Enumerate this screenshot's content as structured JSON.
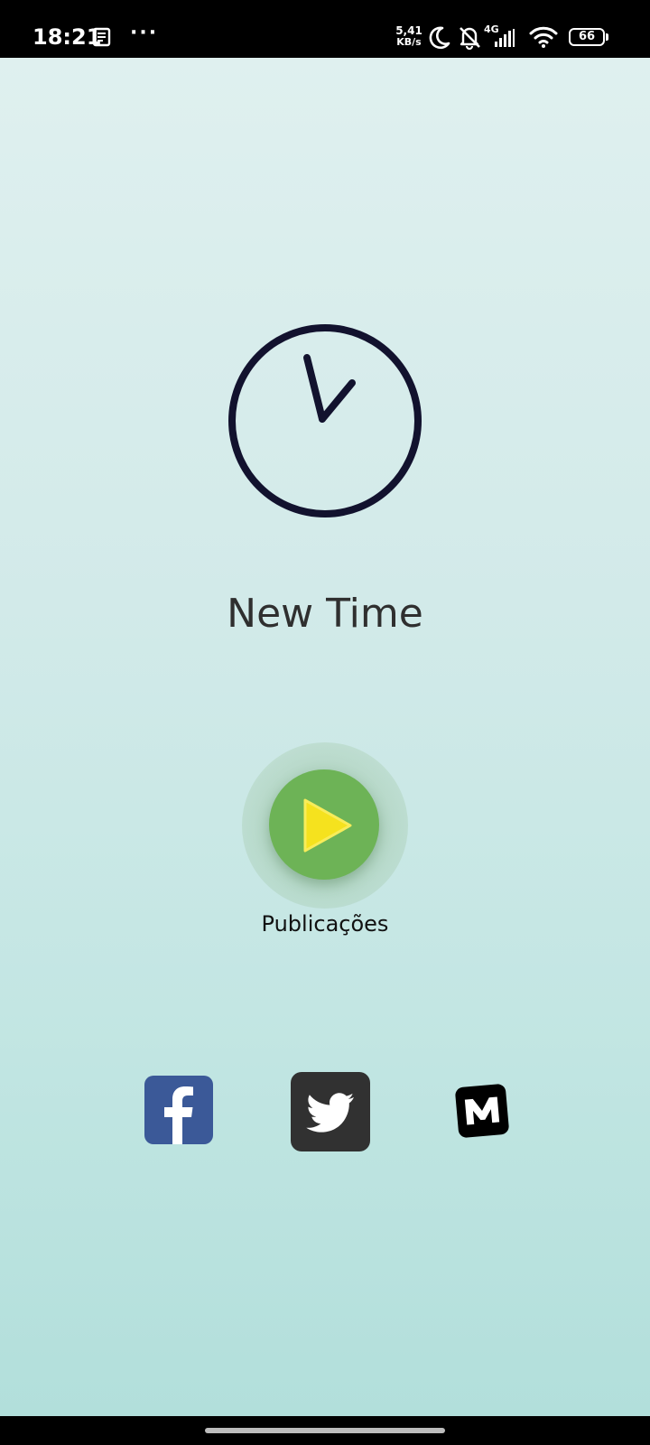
{
  "status_bar": {
    "time": "18:21",
    "more_indicator": "···",
    "net_speed_value": "5,41",
    "net_speed_unit": "KB/s",
    "network_type": "4G",
    "battery_level": "66",
    "icons": [
      "news-icon",
      "moon-icon",
      "bell-off-icon",
      "signal-icon",
      "wifi-icon",
      "battery-icon"
    ]
  },
  "app": {
    "title": "New Time",
    "play_label": "Publicações"
  },
  "social": {
    "items": [
      {
        "name": "facebook-icon",
        "color": "#3b5998"
      },
      {
        "name": "twitter-icon",
        "color": "#313131"
      },
      {
        "name": "medium-icon",
        "color": "#000000"
      }
    ]
  },
  "colors": {
    "background_top": "#dff0ef",
    "background_bottom": "#b2dfdb",
    "clock_stroke": "#12122e",
    "play_button": "#6db356",
    "play_triangle": "#f5e21e"
  }
}
